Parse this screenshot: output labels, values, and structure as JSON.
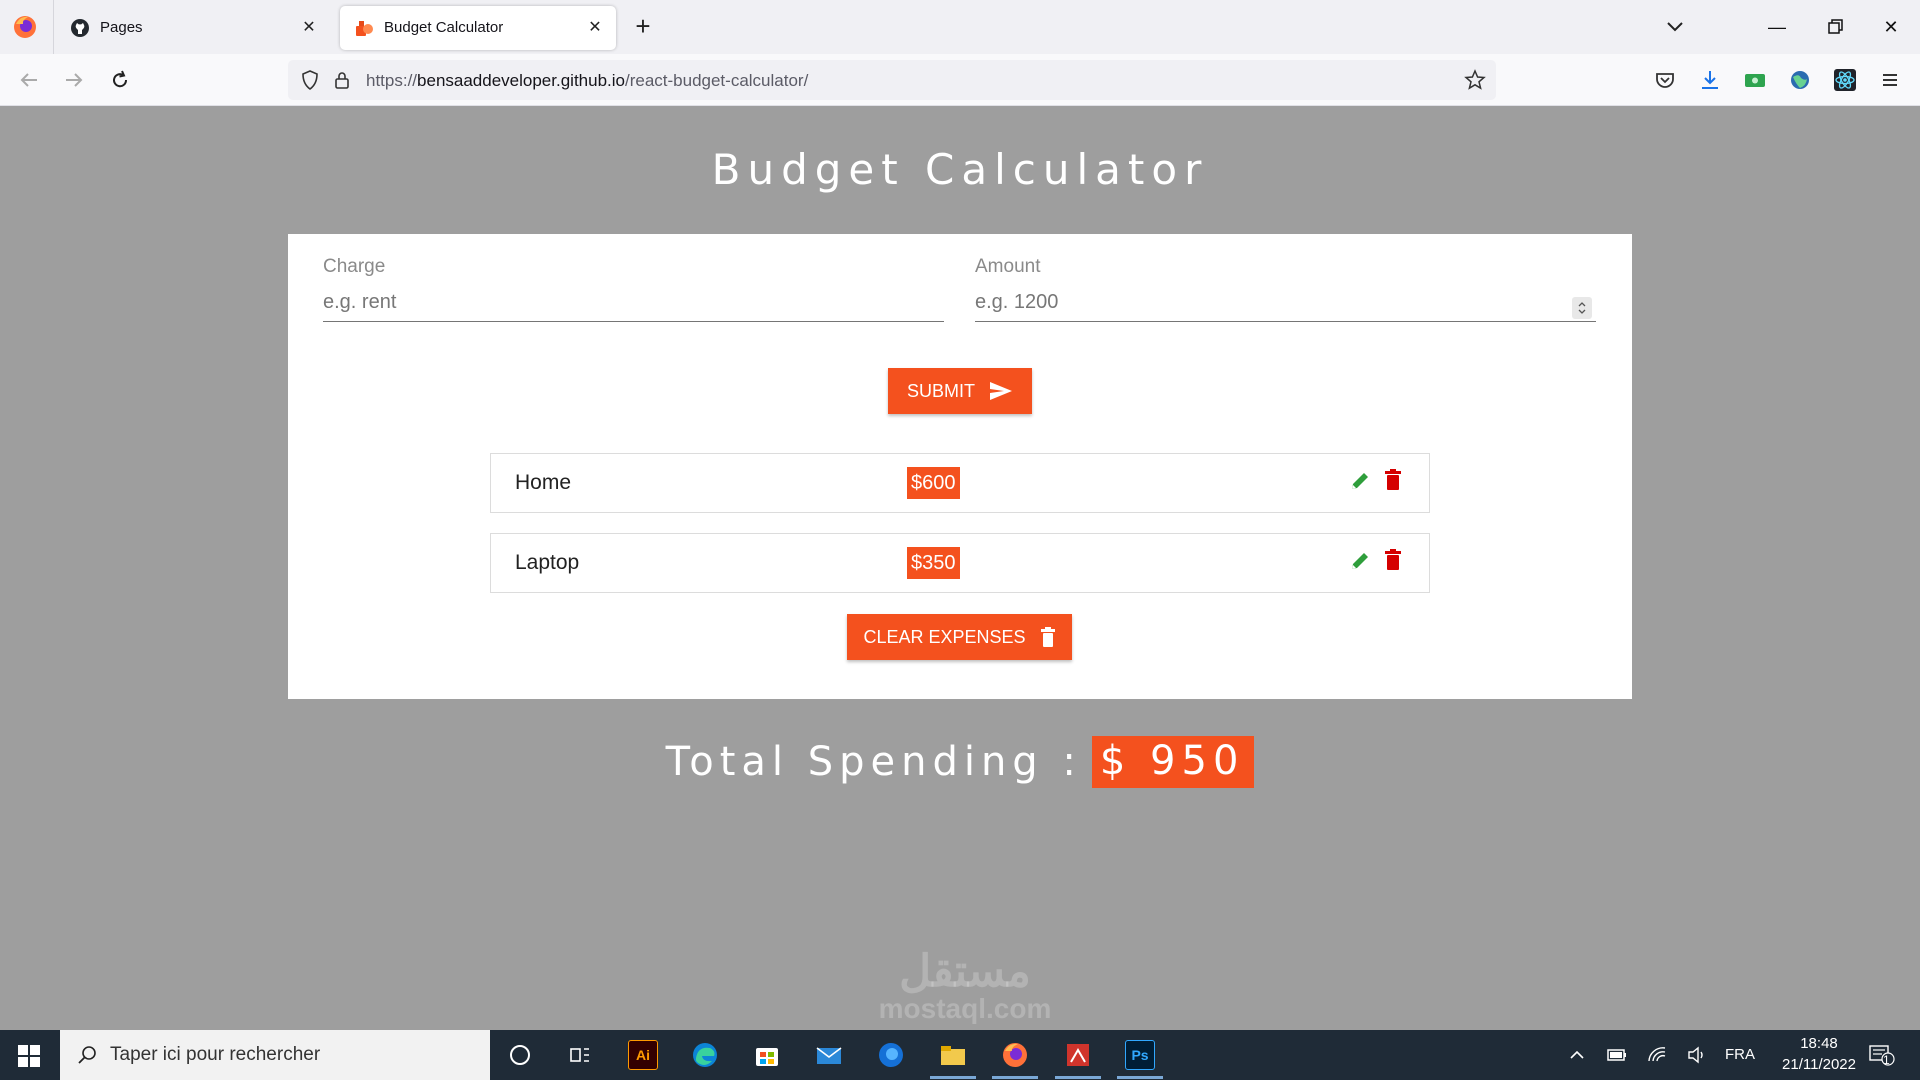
{
  "browser": {
    "tabs": [
      {
        "label": "Pages",
        "active": false
      },
      {
        "label": "Budget Calculator",
        "active": true
      }
    ],
    "url": {
      "scheme": "https://",
      "host": "bensaaddeveloper.github.io",
      "path": "/react-budget-calculator/"
    }
  },
  "app": {
    "title": "Budget Calculator",
    "form": {
      "charge_label": "Charge",
      "charge_placeholder": "e.g. rent",
      "amount_label": "Amount",
      "amount_placeholder": "e.g. 1200",
      "submit_label": "SUBMIT"
    },
    "expenses": [
      {
        "name": "Home",
        "amount": "$600"
      },
      {
        "name": "Laptop",
        "amount": "$350"
      }
    ],
    "clear_label": "CLEAR EXPENSES",
    "total_label": "Total Spending :",
    "total_value": "$ 950"
  },
  "watermark": {
    "arabic": "مستقل",
    "latin": "mostaql.com"
  },
  "taskbar": {
    "search_placeholder": "Taper ici pour rechercher",
    "language": "FRA",
    "time": "18:48",
    "date": "21/11/2022",
    "notification_count": "1"
  },
  "colors": {
    "accent": "#f4511e",
    "page_bg": "#9e9e9e",
    "edit_green": "#2e9e3b",
    "delete_red": "#d50000"
  }
}
